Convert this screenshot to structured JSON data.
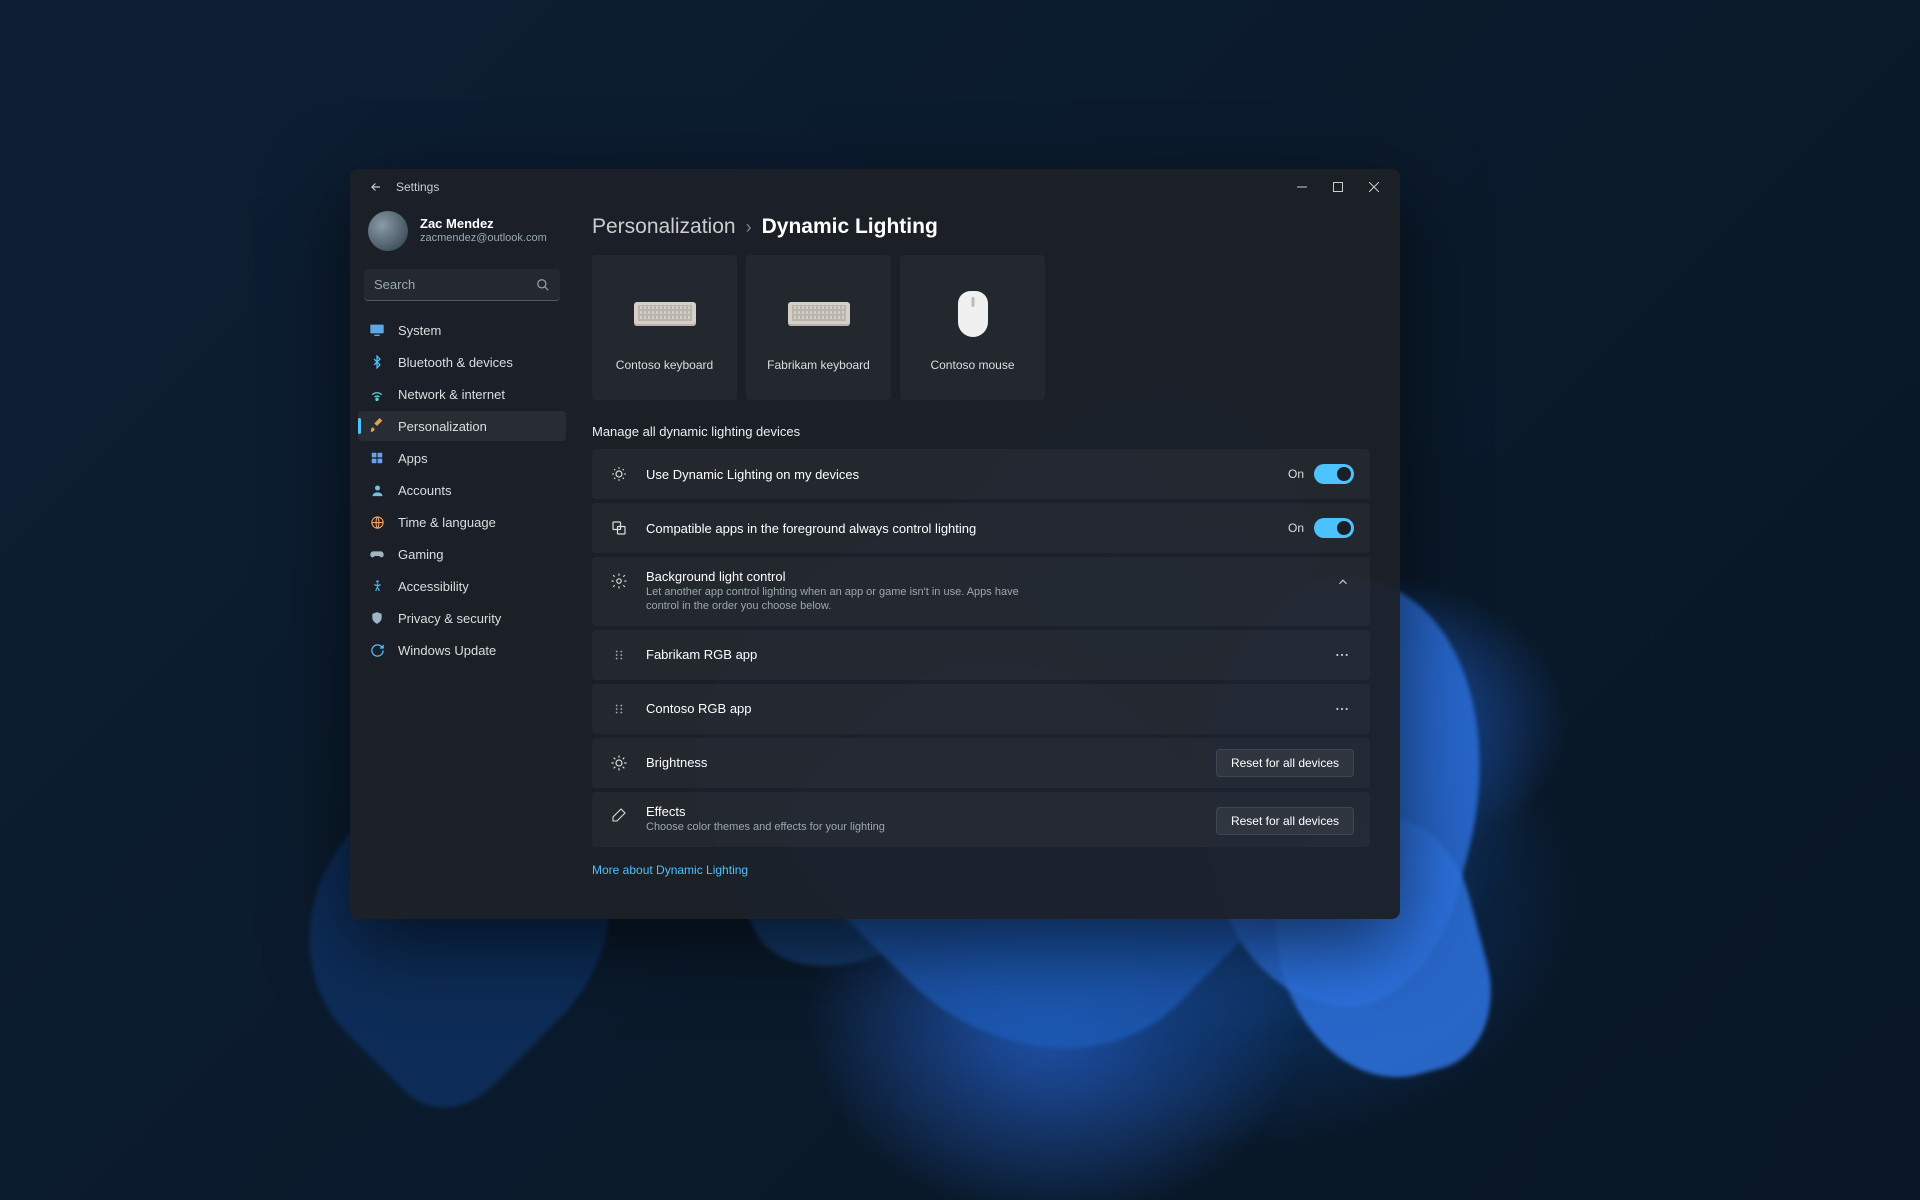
{
  "titlebar": {
    "title": "Settings"
  },
  "user": {
    "name": "Zac Mendez",
    "email": "zacmendez@outlook.com"
  },
  "search": {
    "placeholder": "Search"
  },
  "sidebar": {
    "items": [
      {
        "icon": "monitor",
        "label": "System",
        "color": "#5aa9e6"
      },
      {
        "icon": "bluetooth",
        "label": "Bluetooth & devices",
        "color": "#4cc2ff"
      },
      {
        "icon": "wifi",
        "label": "Network & internet",
        "color": "#60d2d8"
      },
      {
        "icon": "brush",
        "label": "Personalization",
        "color": "#e0a050",
        "selected": true
      },
      {
        "icon": "grid",
        "label": "Apps",
        "color": "#6aa0e8"
      },
      {
        "icon": "person",
        "label": "Accounts",
        "color": "#77c1d8"
      },
      {
        "icon": "globe",
        "label": "Time & language",
        "color": "#f0a060"
      },
      {
        "icon": "gamepad",
        "label": "Gaming",
        "color": "#a0b4c4"
      },
      {
        "icon": "person-walk",
        "label": "Accessibility",
        "color": "#50b0e0"
      },
      {
        "icon": "shield",
        "label": "Privacy & security",
        "color": "#a0b4c4"
      },
      {
        "icon": "cycle",
        "label": "Windows Update",
        "color": "#4cc2ff"
      }
    ]
  },
  "breadcrumb": {
    "parent": "Personalization",
    "current": "Dynamic Lighting"
  },
  "devices": [
    {
      "label": "Contoso keyboard",
      "kind": "keyboard"
    },
    {
      "label": "Fabrikam keyboard",
      "kind": "keyboard"
    },
    {
      "label": "Contoso mouse",
      "kind": "mouse"
    }
  ],
  "sectionLabel": "Manage all dynamic lighting devices",
  "settings": {
    "useDynamic": {
      "title": "Use Dynamic Lighting on my devices",
      "state": "On"
    },
    "compatApps": {
      "title": "Compatible apps in the foreground always control lighting",
      "state": "On"
    },
    "bgControl": {
      "title": "Background light control",
      "desc": "Let another app control lighting when an app or game isn't in use. Apps have control in the order you choose below."
    },
    "bgApps": [
      {
        "name": "Fabrikam RGB app"
      },
      {
        "name": "Contoso RGB app"
      }
    ],
    "brightness": {
      "title": "Brightness",
      "button": "Reset for all devices"
    },
    "effects": {
      "title": "Effects",
      "desc": "Choose color themes and effects for your lighting",
      "button": "Reset for all devices"
    }
  },
  "learnMore": "More about Dynamic Lighting"
}
